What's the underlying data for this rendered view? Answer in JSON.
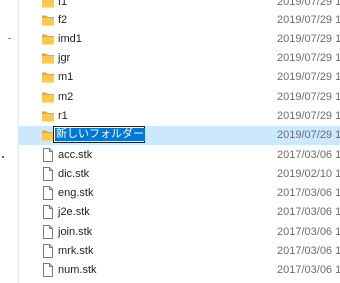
{
  "files": [
    {
      "name": "f1",
      "date": "2019/07/29 1",
      "type": "folder"
    },
    {
      "name": "f2",
      "date": "2019/07/29 1",
      "type": "folder"
    },
    {
      "name": "imd1",
      "date": "2019/07/29 1",
      "type": "folder"
    },
    {
      "name": "jgr",
      "date": "2019/07/29 1",
      "type": "folder"
    },
    {
      "name": "m1",
      "date": "2019/07/29 1",
      "type": "folder"
    },
    {
      "name": "m2",
      "date": "2019/07/29 1",
      "type": "folder"
    },
    {
      "name": "r1",
      "date": "2019/07/29 1",
      "type": "folder"
    },
    {
      "name": "新しいフォルダー",
      "date": "2019/07/29 1",
      "type": "folder",
      "renaming": true
    },
    {
      "name": "acc.stk",
      "date": "2017/03/06 1",
      "type": "file"
    },
    {
      "name": "dic.stk",
      "date": "2019/02/10 1",
      "type": "file"
    },
    {
      "name": "eng.stk",
      "date": "2017/03/06 1",
      "type": "file"
    },
    {
      "name": "j2e.stk",
      "date": "2017/03/06 1",
      "type": "file"
    },
    {
      "name": "join.stk",
      "date": "2017/03/06 1",
      "type": "file"
    },
    {
      "name": "mrk.stk",
      "date": "2017/03/06 1",
      "type": "file"
    },
    {
      "name": "num.stk",
      "date": "2017/03/06 1",
      "type": "file"
    }
  ],
  "colors": {
    "folder": "#f8c84f",
    "folder_dark": "#e3a93b",
    "selection_bg": "#cce8ff",
    "text_selection": "#0078d7",
    "date_text": "#6d6d6d"
  },
  "icons": {
    "folder": "folder-icon",
    "file": "file-icon"
  }
}
